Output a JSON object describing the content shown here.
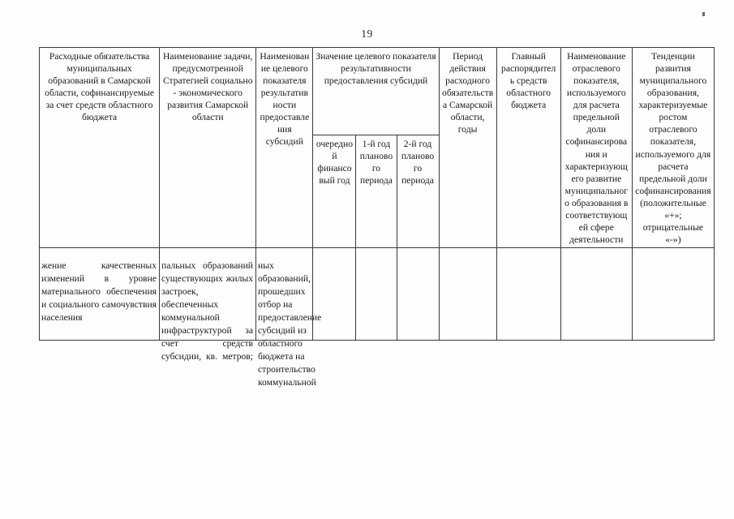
{
  "page": {
    "number": "19"
  },
  "table": {
    "headers": {
      "col1": "Расходные обязательства муниципальных образований в Самарской области, софинансируемые за счет средств областного бюджета",
      "col2": "Наименование задачи, предусмотренной Стратегией социально - экономического развития Самарской области",
      "col3": "Наименование целевого показателя результативности предоставления субсидий",
      "col4_group": "Значение целевого показателя результативности предоставления субсидий",
      "col4_sub1": "очередной финансовый год",
      "col4_sub2": "1-й год планового периода",
      "col4_sub3": "2-й год планового периода",
      "col5": "Период действия расходного обязательства Самарской области, годы",
      "col6": "Главный распорядитель средств областного бюджета",
      "col7": "Наименование отраслевого показателя, используемого для расчета предельной доли софинансирования и характеризующего развитие муниципального образования в соответствующей сфере деятельности",
      "col8": "Тенденции развития муниципального образования, характеризуемые ростом отраслевого показателя, используемого для расчета предельной доли софинансирования (положительные «+»; отрицательные «-»)"
    }
  },
  "body_flow": {
    "col1": "жение качественных изменений в уровне материального обеспечения и социального самочувствия населения",
    "col2": "пальных образований существующих жилых застроек, обеспеченных коммунальной инфраструктурой за счет средств субсидии, кв. метров;",
    "col3": "ных образований, прошедших отбор на предоставление субсидий из областного бюджета на строительство коммунальной"
  }
}
